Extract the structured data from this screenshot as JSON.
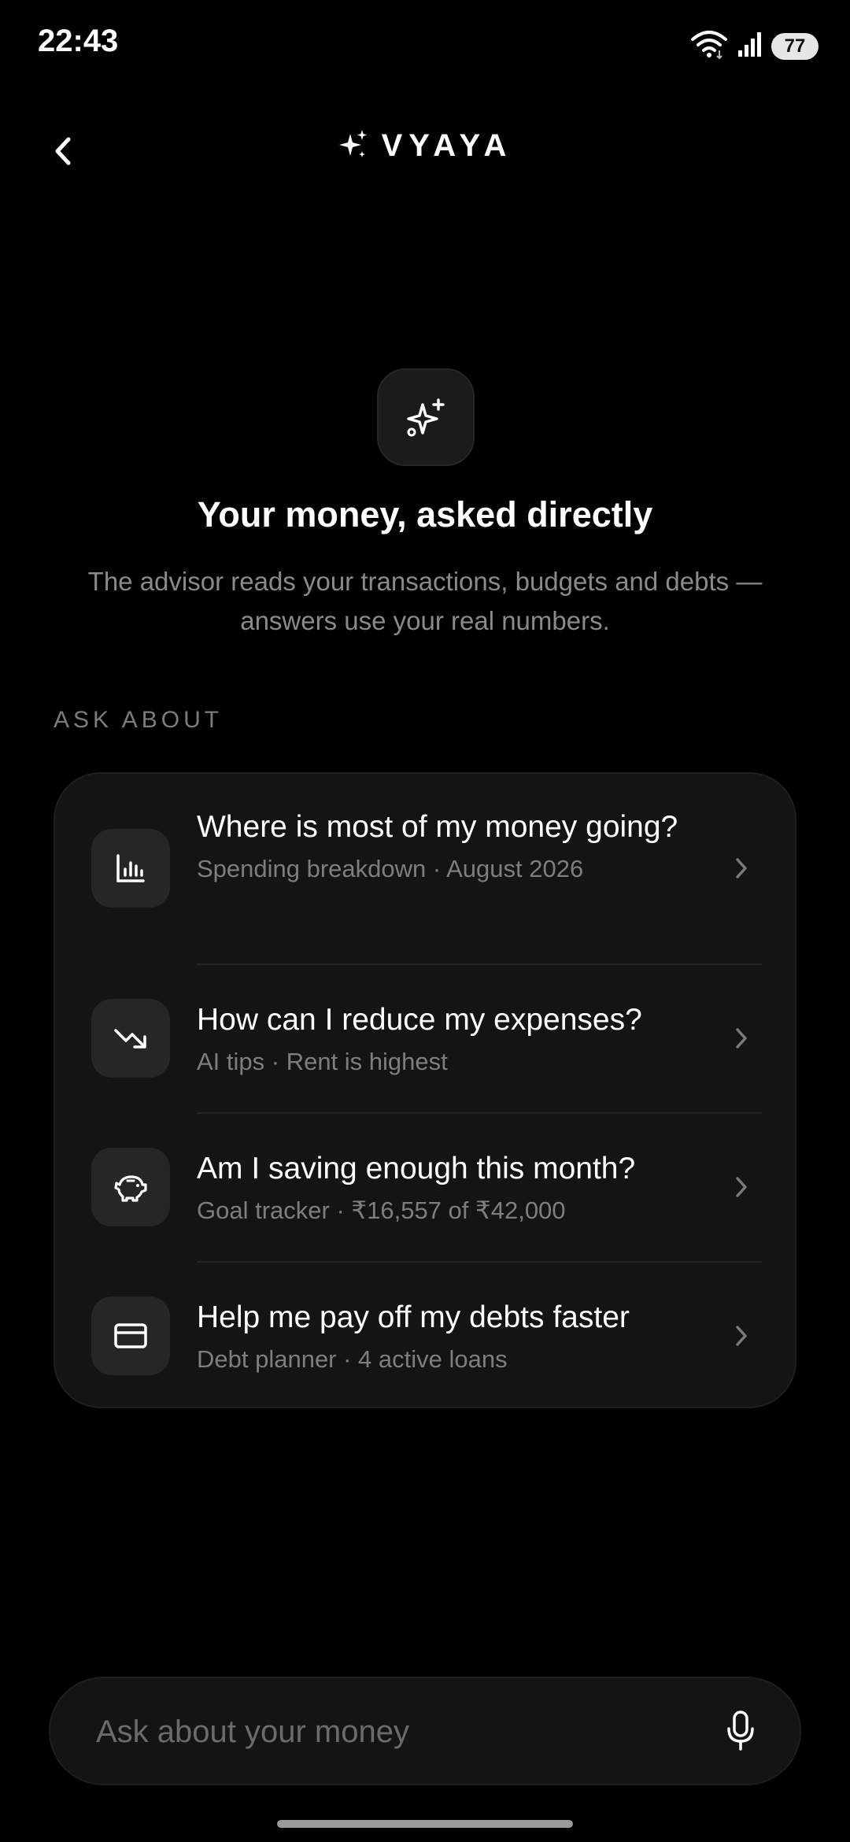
{
  "status": {
    "time": "22:43",
    "battery": "77"
  },
  "header": {
    "brand": "VYAYA"
  },
  "hero": {
    "title": "Your money, asked directly",
    "subtitle": "The advisor reads your transactions, budgets and debts — answers use your real numbers."
  },
  "section": {
    "label": "ASK ABOUT"
  },
  "suggestions": [
    {
      "icon": "bar-chart-icon",
      "title": "Where is most of my money going?",
      "subtitle": "Spending breakdown · August 2026"
    },
    {
      "icon": "trending-down-icon",
      "title": "How can I reduce my expenses?",
      "subtitle": "AI tips · Rent is highest"
    },
    {
      "icon": "piggy-bank-icon",
      "title": "Am I saving enough this month?",
      "subtitle": "Goal tracker · ₹16,557 of ₹42,000"
    },
    {
      "icon": "credit-card-icon",
      "title": "Help me pay off my debts faster",
      "subtitle": "Debt planner · 4 active loans"
    }
  ],
  "input": {
    "placeholder": "Ask about your money",
    "value": ""
  },
  "colors": {
    "background": "#000000",
    "card": "#141414",
    "icon_tile": "#262626",
    "muted_text": "#7e7e7e"
  }
}
